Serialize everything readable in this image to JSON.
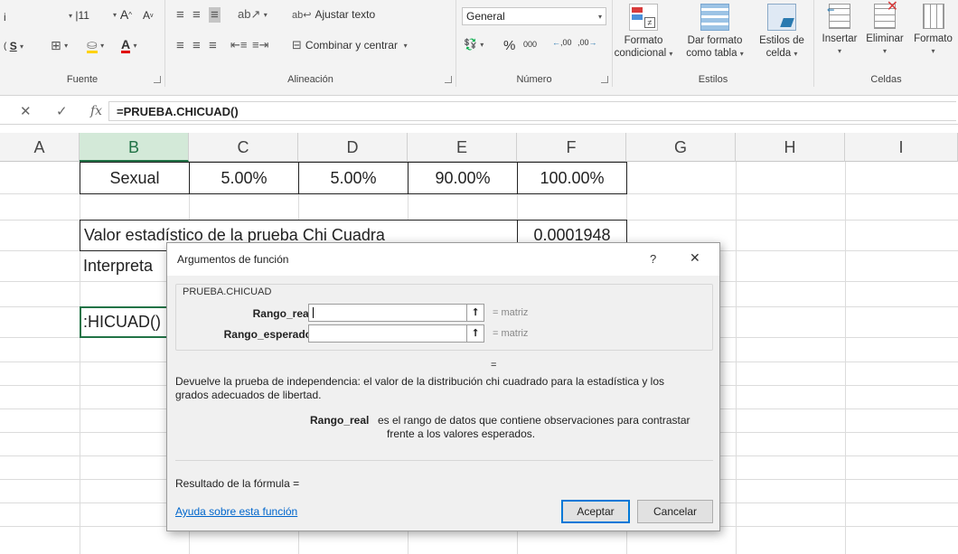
{
  "ribbon": {
    "font_partial": "i",
    "font_size": "11",
    "grow_label": "A",
    "shrink_label": "A",
    "underline_label": "S",
    "font_color_label": "A",
    "wrap_text_label": "Ajustar texto",
    "merge_center_label": "Combinar y centrar",
    "number_format": "General",
    "percent_label": "%",
    "thousands_label": "000",
    "increase_decimals_label": ",00",
    "decrease_decimals_label": ",00",
    "groups": {
      "font": "Fuente",
      "alignment": "Alineación",
      "number": "Número",
      "styles": "Estilos",
      "cells": "Celdas"
    },
    "conditional_format": [
      "Formato",
      "condicional"
    ],
    "format_table": [
      "Dar formato",
      "como tabla"
    ],
    "cell_styles": [
      "Estilos de",
      "celda"
    ],
    "insert": "Insertar",
    "delete": "Eliminar",
    "format": "Formato"
  },
  "formula_bar": {
    "cancel_icon": "close-icon",
    "enter_icon": "check-icon",
    "fx_label": "fx",
    "formula": "=PRUEBA.CHICUAD()"
  },
  "columns": [
    "A",
    "B",
    "C",
    "D",
    "E",
    "F",
    "G",
    "H",
    "I"
  ],
  "active_column": "B",
  "cells": {
    "row_sexual": [
      "Sexual",
      "5.00%",
      "5.00%",
      "90.00%",
      "100.00%"
    ],
    "chi_label": "Valor estadístico de la prueba Chi Cuadra",
    "chi_value": "0.0001948",
    "interp_label": "Interpreta",
    "active_cell": ":HICUAD()"
  },
  "dialog": {
    "title": "Argumentos de función",
    "help_btn": "?",
    "close_btn": "X",
    "function_name": "PRUEBA.CHICUAD",
    "args": [
      {
        "label": "Rango_real",
        "result": "=  matriz"
      },
      {
        "label": "Rango_esperado",
        "result": "=  matriz"
      }
    ],
    "overall_result": "=",
    "description": [
      "Devuelve la prueba de independencia: el valor de la distribución chi cuadrado para la estadística y los",
      "grados adecuados de libertad."
    ],
    "arg_help_label": "Rango_real",
    "arg_help_text": [
      "es el rango de datos que contiene observaciones para contrastar",
      "frente a los valores esperados."
    ],
    "formula_result": "Resultado de la fórmula =",
    "help_link": "Ayuda sobre esta función",
    "ok": "Aceptar",
    "cancel": "Cancelar"
  }
}
